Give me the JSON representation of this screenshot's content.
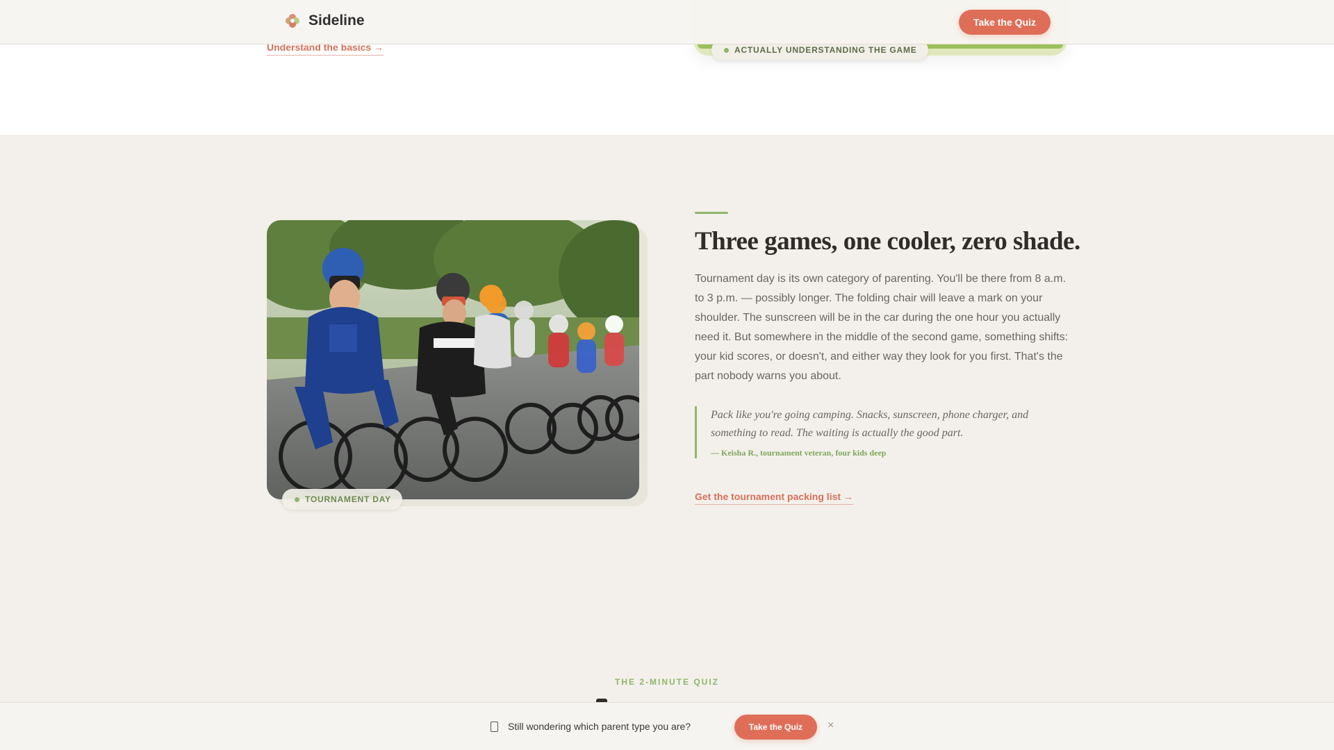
{
  "header": {
    "brand_name": "Sideline",
    "cta_label": "Take the Quiz"
  },
  "previous_section": {
    "link_label": "Understand the basics →",
    "chip_label": "ACTUALLY UNDERSTANDING THE GAME"
  },
  "tournament": {
    "photo_chip_label": "TOURNAMENT DAY",
    "title": "Three games, one cooler, zero shade.",
    "body": "Tournament day is its own category of parenting. You'll be there from 8 a.m. to 3 p.m. — possibly longer. The folding chair will leave a mark on your shoulder. The sunscreen will be in the car during the one hour you actually need it. But somewhere in the middle of the second game, something shifts: your kid scores, or doesn't, and either way they look for you first. That's the part nobody warns you about.",
    "quote": {
      "text": "Pack like you're going camping. Snacks, sunscreen, phone charger, and something to read. The waiting is actually the good part.",
      "cite": "— Keisha R., tournament veteran, four kids deep"
    },
    "link_label": "Get the tournament packing list →"
  },
  "quiz": {
    "eyebrow": "THE 2-MINUTE QUIZ"
  },
  "sticky_bar": {
    "text": "Still wondering which parent type you are?",
    "cta_label": "Take the Quiz",
    "close_symbol": "×"
  },
  "icons": {
    "brand": "flower-logo-icon",
    "sticky": "clipboard-icon",
    "close": "close-icon"
  },
  "colors": {
    "accent": "#df6e58",
    "green": "#8fb56a",
    "background": "#f3f0eb"
  }
}
